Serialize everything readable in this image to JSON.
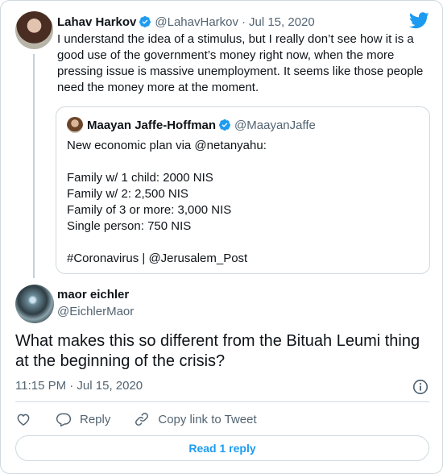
{
  "colors": {
    "accent": "#1d9bf0",
    "muted": "#536471",
    "border": "#cfd9de",
    "text": "#0f1419"
  },
  "parent": {
    "name": "Lahav Harkov",
    "handle": "@LahavHarkov",
    "separator": "·",
    "date": "Jul 15, 2020",
    "text": "I understand the idea of a stimulus, but I really don’t see how it is a good use of the government’s money right now, when the more pressing issue is massive unemployment. It seems like those people need the money more at the moment.",
    "icons": {
      "verified": "verified-badge-icon",
      "brand": "twitter-bird-icon"
    }
  },
  "quote": {
    "name": "Maayan Jaffe-Hoffman",
    "handle": "@MaayanJaffe",
    "lines": [
      "New economic plan via @netanyahu:",
      "",
      "Family w/ 1 child: 2000 NIS",
      "Family w/ 2: 2,500 NIS",
      "Family of 3 or more: 3,000 NIS",
      "Single person: 750 NIS",
      "",
      "#Coronavirus | @Jerusalem_Post"
    ]
  },
  "reply": {
    "name": "maor eichler",
    "handle": "@EichlerMaor",
    "text": "What makes this so different from the Bituah Leumi thing at the beginning of the crisis?",
    "time": "11:15 PM · Jul 15, 2020"
  },
  "actions": {
    "reply_label": "Reply",
    "copy_label": "Copy link to Tweet",
    "read_replies_label": "Read 1 reply",
    "icons": {
      "like": "heart-icon",
      "reply": "speech-bubble-icon",
      "copy": "link-icon",
      "info": "info-icon"
    }
  }
}
